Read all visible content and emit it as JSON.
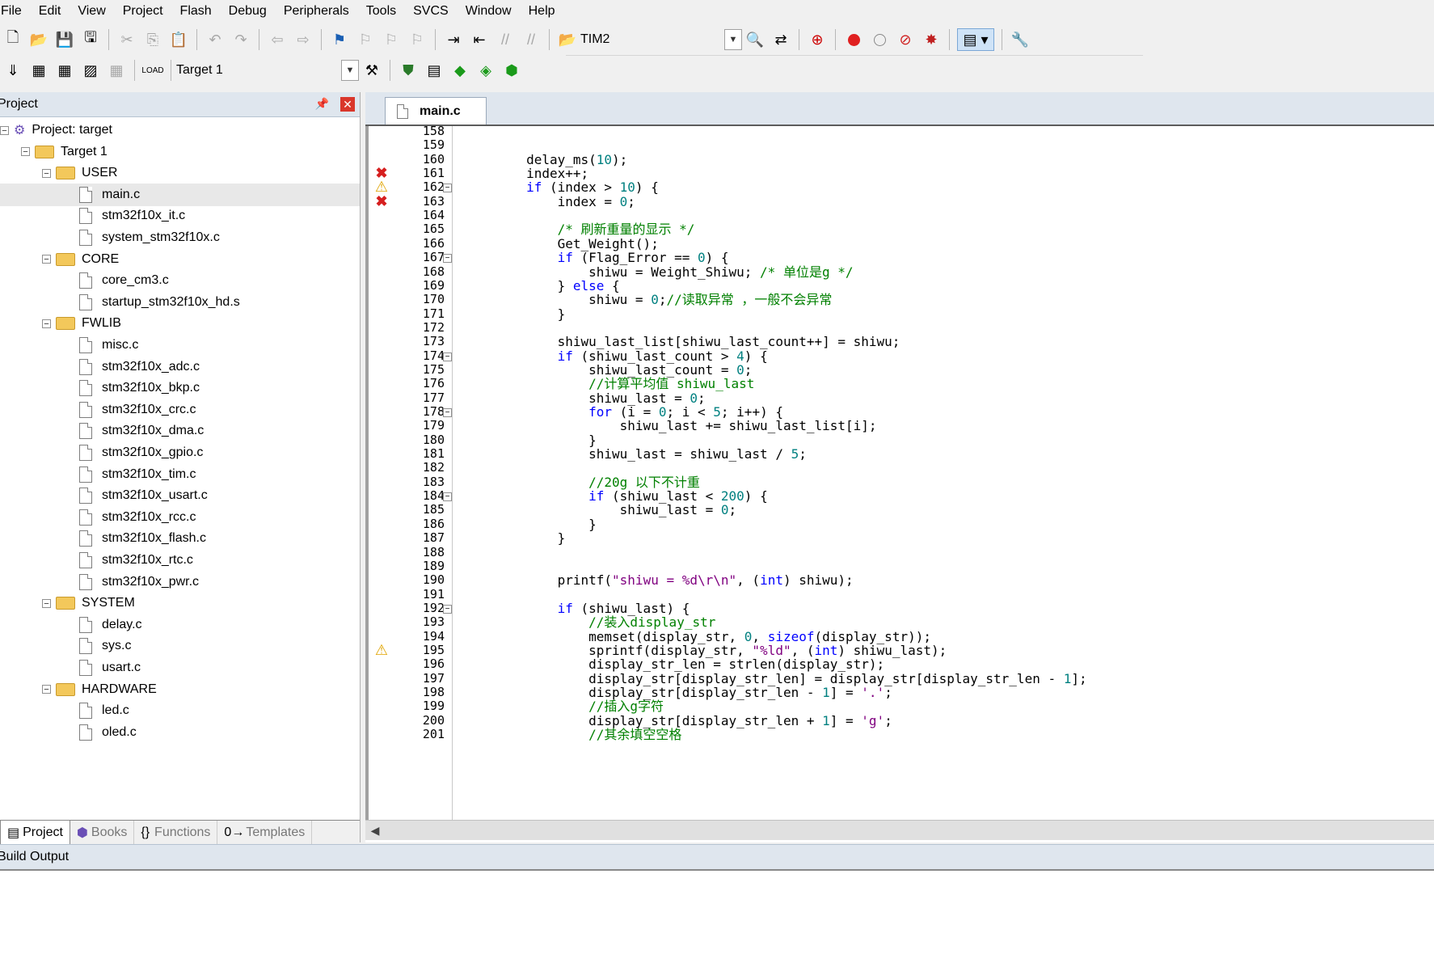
{
  "menu": [
    "File",
    "Edit",
    "View",
    "Project",
    "Flash",
    "Debug",
    "Peripherals",
    "Tools",
    "SVCS",
    "Window",
    "Help"
  ],
  "toolbar1": {
    "target_combo": "TIM2"
  },
  "toolbar2": {
    "target_select": "Target 1"
  },
  "project_panel": {
    "title": "Project",
    "tree": [
      {
        "label": "Project: target",
        "level": 0,
        "type": "root"
      },
      {
        "label": "Target 1",
        "level": 1,
        "type": "target"
      },
      {
        "label": "USER",
        "level": 2,
        "type": "folder"
      },
      {
        "label": "main.c",
        "level": 3,
        "type": "file",
        "selected": true
      },
      {
        "label": "stm32f10x_it.c",
        "level": 3,
        "type": "file"
      },
      {
        "label": "system_stm32f10x.c",
        "level": 3,
        "type": "file"
      },
      {
        "label": "CORE",
        "level": 2,
        "type": "folder"
      },
      {
        "label": "core_cm3.c",
        "level": 3,
        "type": "file"
      },
      {
        "label": "startup_stm32f10x_hd.s",
        "level": 3,
        "type": "file"
      },
      {
        "label": "FWLIB",
        "level": 2,
        "type": "folder"
      },
      {
        "label": "misc.c",
        "level": 3,
        "type": "file"
      },
      {
        "label": "stm32f10x_adc.c",
        "level": 3,
        "type": "file"
      },
      {
        "label": "stm32f10x_bkp.c",
        "level": 3,
        "type": "file"
      },
      {
        "label": "stm32f10x_crc.c",
        "level": 3,
        "type": "file"
      },
      {
        "label": "stm32f10x_dma.c",
        "level": 3,
        "type": "file"
      },
      {
        "label": "stm32f10x_gpio.c",
        "level": 3,
        "type": "file"
      },
      {
        "label": "stm32f10x_tim.c",
        "level": 3,
        "type": "file"
      },
      {
        "label": "stm32f10x_usart.c",
        "level": 3,
        "type": "file"
      },
      {
        "label": "stm32f10x_rcc.c",
        "level": 3,
        "type": "file"
      },
      {
        "label": "stm32f10x_flash.c",
        "level": 3,
        "type": "file"
      },
      {
        "label": "stm32f10x_rtc.c",
        "level": 3,
        "type": "file"
      },
      {
        "label": "stm32f10x_pwr.c",
        "level": 3,
        "type": "file"
      },
      {
        "label": "SYSTEM",
        "level": 2,
        "type": "folder"
      },
      {
        "label": "delay.c",
        "level": 3,
        "type": "file"
      },
      {
        "label": "sys.c",
        "level": 3,
        "type": "file"
      },
      {
        "label": "usart.c",
        "level": 3,
        "type": "file"
      },
      {
        "label": "HARDWARE",
        "level": 2,
        "type": "folder"
      },
      {
        "label": "led.c",
        "level": 3,
        "type": "file"
      },
      {
        "label": "oled.c",
        "level": 3,
        "type": "file"
      }
    ],
    "bottom_tabs": [
      {
        "label": "Project",
        "active": true,
        "icon": "project-tab-icon"
      },
      {
        "label": "Books",
        "active": false,
        "icon": "books-icon"
      },
      {
        "label": "Functions",
        "active": false,
        "icon": "functions-icon"
      },
      {
        "label": "Templates",
        "active": false,
        "icon": "templates-icon"
      }
    ]
  },
  "editor": {
    "tab": "main.c",
    "lines": [
      {
        "n": 158,
        "mark": "",
        "fold": false,
        "t": []
      },
      {
        "n": 159,
        "mark": "",
        "fold": false,
        "t": []
      },
      {
        "n": 160,
        "mark": "",
        "fold": false,
        "t": [
          [
            "",
            "        delay_ms("
          ],
          [
            "num",
            "10"
          ],
          [
            "",
            ");"
          ]
        ]
      },
      {
        "n": 161,
        "mark": "error",
        "fold": false,
        "t": [
          [
            "",
            "        index++;"
          ]
        ]
      },
      {
        "n": 162,
        "mark": "warning",
        "fold": true,
        "t": [
          [
            "",
            "        "
          ],
          [
            "kw",
            "if"
          ],
          [
            "",
            " (index > "
          ],
          [
            "num",
            "10"
          ],
          [
            "",
            ") {"
          ]
        ]
      },
      {
        "n": 163,
        "mark": "error",
        "fold": false,
        "t": [
          [
            "",
            "            index = "
          ],
          [
            "num",
            "0"
          ],
          [
            "",
            ";"
          ]
        ]
      },
      {
        "n": 164,
        "mark": "",
        "fold": false,
        "t": []
      },
      {
        "n": 165,
        "mark": "",
        "fold": false,
        "t": [
          [
            "",
            "            "
          ],
          [
            "cm",
            "/* 刷新重量的显示 */"
          ]
        ]
      },
      {
        "n": 166,
        "mark": "",
        "fold": false,
        "t": [
          [
            "",
            "            Get_Weight();"
          ]
        ]
      },
      {
        "n": 167,
        "mark": "",
        "fold": true,
        "t": [
          [
            "",
            "            "
          ],
          [
            "kw",
            "if"
          ],
          [
            "",
            " (Flag_Error == "
          ],
          [
            "num",
            "0"
          ],
          [
            "",
            ") {"
          ]
        ]
      },
      {
        "n": 168,
        "mark": "",
        "fold": false,
        "t": [
          [
            "",
            "                shiwu = Weight_Shiwu; "
          ],
          [
            "cm",
            "/* 单位是g */"
          ]
        ]
      },
      {
        "n": 169,
        "mark": "",
        "fold": false,
        "t": [
          [
            "",
            "            } "
          ],
          [
            "kw",
            "else"
          ],
          [
            "",
            " {"
          ]
        ]
      },
      {
        "n": 170,
        "mark": "",
        "fold": false,
        "t": [
          [
            "",
            "                shiwu = "
          ],
          [
            "num",
            "0"
          ],
          [
            "",
            ";"
          ],
          [
            "cm",
            "//读取异常 ，一般不会异常"
          ]
        ]
      },
      {
        "n": 171,
        "mark": "",
        "fold": false,
        "t": [
          [
            "",
            "            }"
          ]
        ]
      },
      {
        "n": 172,
        "mark": "",
        "fold": false,
        "t": []
      },
      {
        "n": 173,
        "mark": "",
        "fold": false,
        "t": [
          [
            "",
            "            shiwu_last_list[shiwu_last_count++] = shiwu;"
          ]
        ]
      },
      {
        "n": 174,
        "mark": "",
        "fold": true,
        "t": [
          [
            "",
            "            "
          ],
          [
            "kw",
            "if"
          ],
          [
            "",
            " (shiwu_last_count > "
          ],
          [
            "num",
            "4"
          ],
          [
            "",
            ") {"
          ]
        ]
      },
      {
        "n": 175,
        "mark": "",
        "fold": false,
        "t": [
          [
            "",
            "                shiwu_last_count = "
          ],
          [
            "num",
            "0"
          ],
          [
            "",
            ";"
          ]
        ]
      },
      {
        "n": 176,
        "mark": "",
        "fold": false,
        "t": [
          [
            "",
            "                "
          ],
          [
            "cm",
            "//计算平均值 shiwu_last"
          ]
        ]
      },
      {
        "n": 177,
        "mark": "",
        "fold": false,
        "t": [
          [
            "",
            "                shiwu_last = "
          ],
          [
            "num",
            "0"
          ],
          [
            "",
            ";"
          ]
        ]
      },
      {
        "n": 178,
        "mark": "",
        "fold": true,
        "t": [
          [
            "",
            "                "
          ],
          [
            "kw",
            "for"
          ],
          [
            "",
            " (i = "
          ],
          [
            "num",
            "0"
          ],
          [
            "",
            "; i < "
          ],
          [
            "num",
            "5"
          ],
          [
            "",
            "; i++) {"
          ]
        ]
      },
      {
        "n": 179,
        "mark": "",
        "fold": false,
        "t": [
          [
            "",
            "                    shiwu_last += shiwu_last_list[i];"
          ]
        ]
      },
      {
        "n": 180,
        "mark": "",
        "fold": false,
        "t": [
          [
            "",
            "                }"
          ]
        ]
      },
      {
        "n": 181,
        "mark": "",
        "fold": false,
        "t": [
          [
            "",
            "                shiwu_last = shiwu_last / "
          ],
          [
            "num",
            "5"
          ],
          [
            "",
            ";"
          ]
        ]
      },
      {
        "n": 182,
        "mark": "",
        "fold": false,
        "t": []
      },
      {
        "n": 183,
        "mark": "",
        "fold": false,
        "t": [
          [
            "",
            "                "
          ],
          [
            "cm",
            "//20g 以下不计重"
          ]
        ]
      },
      {
        "n": 184,
        "mark": "",
        "fold": true,
        "t": [
          [
            "",
            "                "
          ],
          [
            "kw",
            "if"
          ],
          [
            "",
            " (shiwu_last < "
          ],
          [
            "num",
            "200"
          ],
          [
            "",
            ") {"
          ]
        ]
      },
      {
        "n": 185,
        "mark": "",
        "fold": false,
        "t": [
          [
            "",
            "                    shiwu_last = "
          ],
          [
            "num",
            "0"
          ],
          [
            "",
            ";"
          ]
        ]
      },
      {
        "n": 186,
        "mark": "",
        "fold": false,
        "t": [
          [
            "",
            "                }"
          ]
        ]
      },
      {
        "n": 187,
        "mark": "",
        "fold": false,
        "t": [
          [
            "",
            "            }"
          ]
        ]
      },
      {
        "n": 188,
        "mark": "",
        "fold": false,
        "t": []
      },
      {
        "n": 189,
        "mark": "",
        "fold": false,
        "t": []
      },
      {
        "n": 190,
        "mark": "",
        "fold": false,
        "t": [
          [
            "",
            "            printf("
          ],
          [
            "str",
            "\"shiwu = %d\\r\\n\""
          ],
          [
            "",
            ", ("
          ],
          [
            "kw",
            "int"
          ],
          [
            "",
            ") shiwu);"
          ]
        ]
      },
      {
        "n": 191,
        "mark": "",
        "fold": false,
        "t": []
      },
      {
        "n": 192,
        "mark": "",
        "fold": true,
        "t": [
          [
            "",
            "            "
          ],
          [
            "kw",
            "if"
          ],
          [
            "",
            " (shiwu_last) {"
          ]
        ]
      },
      {
        "n": 193,
        "mark": "",
        "fold": false,
        "t": [
          [
            "",
            "                "
          ],
          [
            "cm",
            "//装入display_str"
          ]
        ]
      },
      {
        "n": 194,
        "mark": "",
        "fold": false,
        "t": [
          [
            "",
            "                memset(display_str, "
          ],
          [
            "num",
            "0"
          ],
          [
            "",
            ", "
          ],
          [
            "kw",
            "sizeof"
          ],
          [
            "",
            "(display_str));"
          ]
        ]
      },
      {
        "n": 195,
        "mark": "warning",
        "fold": false,
        "t": [
          [
            "",
            "                sprintf(display_str, "
          ],
          [
            "str",
            "\"%ld\""
          ],
          [
            "",
            ", ("
          ],
          [
            "kw",
            "int"
          ],
          [
            "",
            ") shiwu_last);"
          ]
        ]
      },
      {
        "n": 196,
        "mark": "",
        "fold": false,
        "t": [
          [
            "",
            "                display_str_len = strlen(display_str);"
          ]
        ]
      },
      {
        "n": 197,
        "mark": "",
        "fold": false,
        "t": [
          [
            "",
            "                display_str[display_str_len] = display_str[display_str_len - "
          ],
          [
            "num",
            "1"
          ],
          [
            "",
            "];"
          ]
        ]
      },
      {
        "n": 198,
        "mark": "",
        "fold": false,
        "t": [
          [
            "",
            "                display_str[display_str_len - "
          ],
          [
            "num",
            "1"
          ],
          [
            "",
            "] = "
          ],
          [
            "str",
            "'.'"
          ],
          [
            "",
            ";"
          ]
        ]
      },
      {
        "n": 199,
        "mark": "",
        "fold": false,
        "t": [
          [
            "",
            "                "
          ],
          [
            "cm",
            "//插入g字符"
          ]
        ]
      },
      {
        "n": 200,
        "mark": "",
        "fold": false,
        "t": [
          [
            "",
            "                display_str[display_str_len + "
          ],
          [
            "num",
            "1"
          ],
          [
            "",
            "] = "
          ],
          [
            "str",
            "'g'"
          ],
          [
            "",
            ";"
          ]
        ]
      },
      {
        "n": 201,
        "mark": "",
        "fold": false,
        "t": [
          [
            "",
            "                "
          ],
          [
            "cm",
            "//其余填空空格"
          ]
        ]
      }
    ]
  },
  "build_output": {
    "title": "Build Output"
  }
}
